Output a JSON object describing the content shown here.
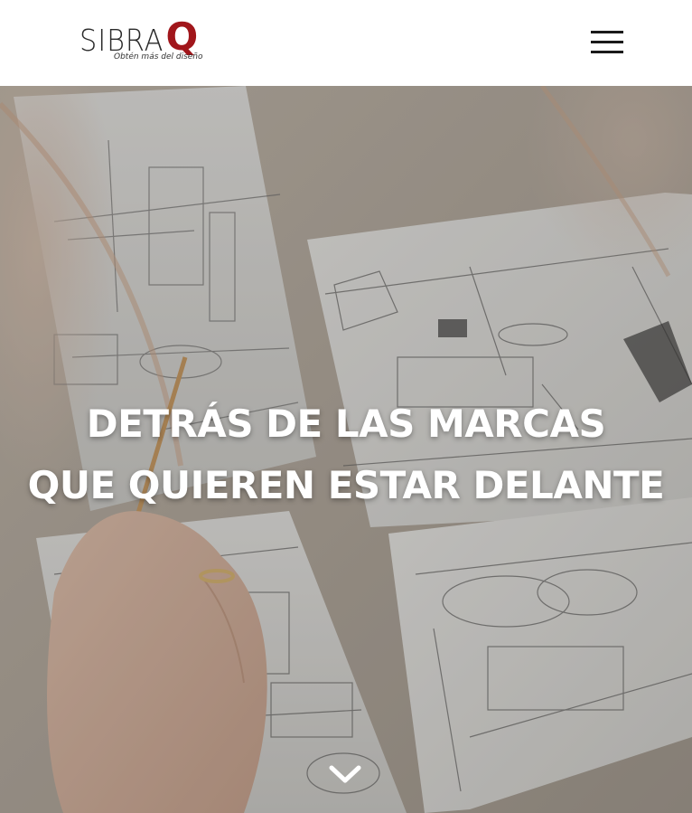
{
  "header": {
    "logo": {
      "brand_main": "SIBRA",
      "brand_accent": "Q",
      "tagline": "Obtén más del diseño"
    },
    "menu_icon": "hamburger-menu-icon"
  },
  "hero": {
    "title_line_1": "DETRÁS DE LAS MARCAS",
    "title_line_2": "QUE QUIEREN ESTAR DELANTE",
    "background_image": "hand-drawing-interior-sketches-photo",
    "scroll_icon": "chevron-down-icon"
  },
  "colors": {
    "brand_accent": "#a1161b",
    "header_bg": "#ffffff",
    "text_dark": "#2a2a2a",
    "hero_text": "#ffffff"
  }
}
